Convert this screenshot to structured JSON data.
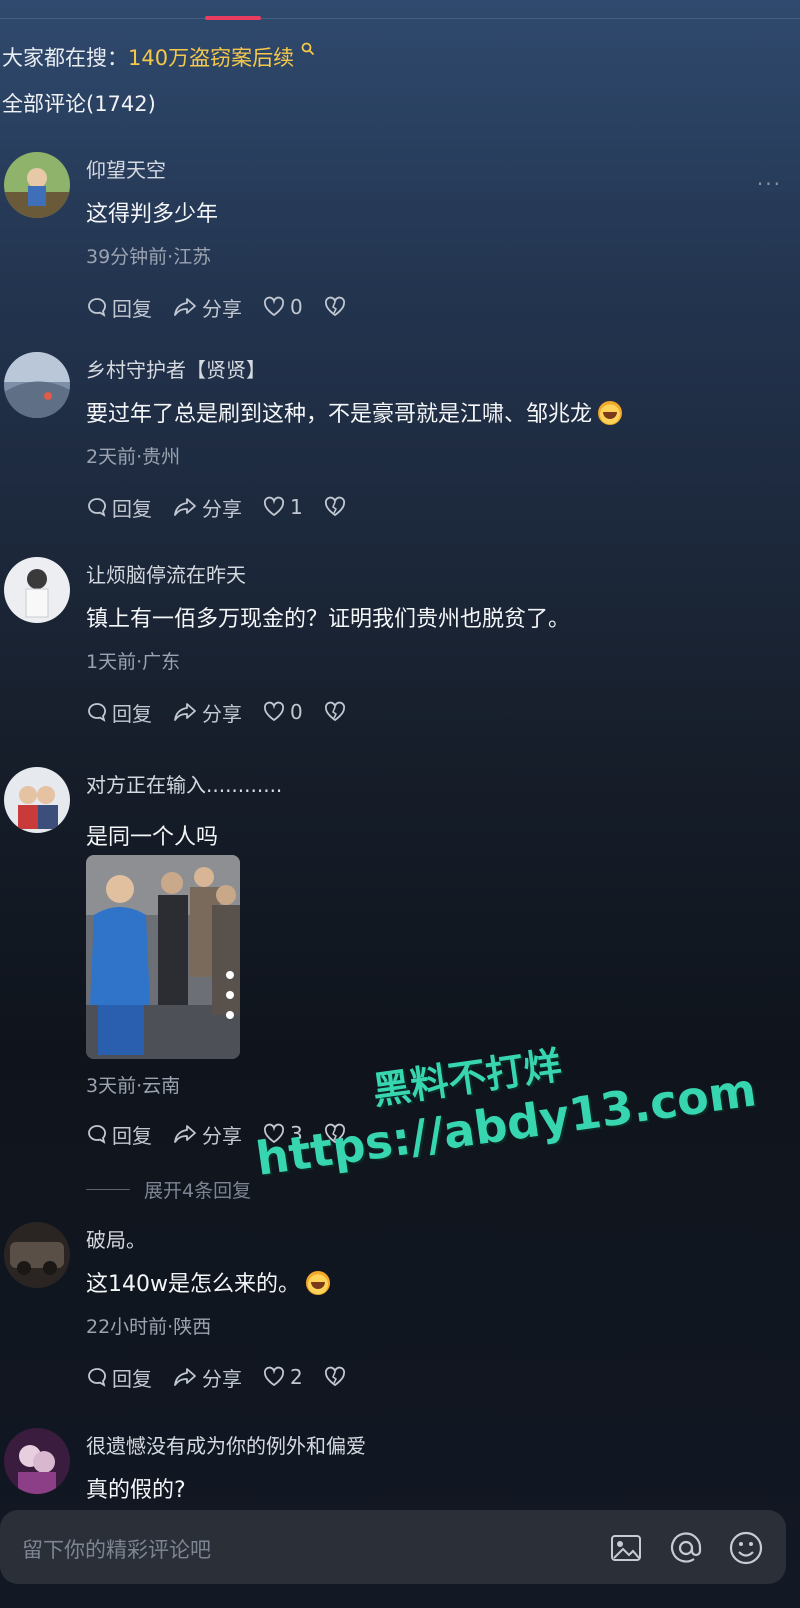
{
  "search": {
    "prefix": "大家都在搜：",
    "hot_term": "140万盗窃案后续"
  },
  "comments_header": {
    "label": "全部评论(1742)"
  },
  "comments": [
    {
      "user": "仰望天空",
      "text": "这得判多少年",
      "meta": "39分钟前·江苏",
      "reply": "回复",
      "share": "分享",
      "likes": "0"
    },
    {
      "user": "乡村守护者【贤贤】",
      "text": "要过年了总是刷到这种，不是豪哥就是江啸、邹兆龙",
      "meta": "2天前·贵州",
      "reply": "回复",
      "share": "分享",
      "likes": "1"
    },
    {
      "user": "让烦脑停流在昨天",
      "text": "镇上有一佰多万现金的？证明我们贵州也脱贫了。",
      "meta": "1天前·广东",
      "reply": "回复",
      "share": "分享",
      "likes": "0"
    },
    {
      "user": "对方正在输入............",
      "text": "是同一个人吗",
      "meta": "3天前·云南",
      "reply": "回复",
      "share": "分享",
      "likes": "3"
    },
    {
      "user": "破局。",
      "text": "这140w是怎么来的。",
      "meta": "22小时前·陕西",
      "reply": "回复",
      "share": "分享",
      "likes": "2"
    },
    {
      "user": "很遗憾没有成为你的例外和偏爱",
      "text": "真的假的?"
    }
  ],
  "expand": {
    "label": "展开4条回复"
  },
  "watermark": {
    "line1": "黑料不打烊",
    "line2": "https://abdy13.com"
  },
  "input": {
    "placeholder": "留下你的精彩评论吧"
  },
  "icons": {
    "image": "image-icon",
    "mention": "at-icon",
    "emoji": "emoji-icon",
    "more": "more-icon"
  },
  "colors": {
    "accent": "#ea3c5e",
    "hot_search": "#f5c84b",
    "watermark": "#37d6b1"
  }
}
